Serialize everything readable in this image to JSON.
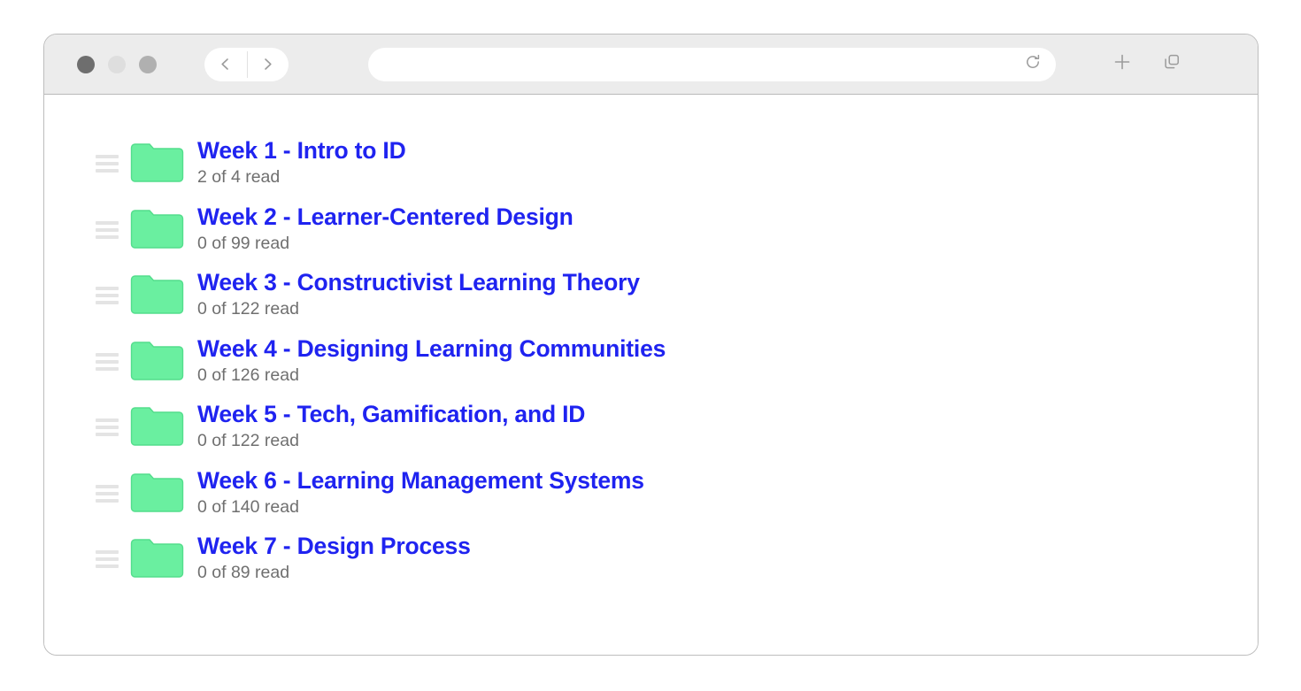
{
  "window": {
    "traffic_lights": [
      {
        "name": "close",
        "color": "#6e6e6e"
      },
      {
        "name": "minimize",
        "color": "#dedede"
      },
      {
        "name": "maximize",
        "color": "#b0b0b0"
      }
    ],
    "back_icon": "chevron-left-icon",
    "forward_icon": "chevron-right-icon",
    "reload_icon": "reload-icon",
    "new_tab_icon": "plus-icon",
    "tab_overview_icon": "tab-overview-icon"
  },
  "address_bar": {
    "value": "",
    "placeholder": ""
  },
  "theme": {
    "title_color": "#1f23f0",
    "subtitle_color": "#6f6f6f",
    "folder_color": "#6aefa0",
    "folder_color_dark": "#53dd8c",
    "toolbar_bg": "#ececec",
    "page_bg": "#ffffff"
  },
  "main": {
    "folders": [
      {
        "title": "Week 1 - Intro to ID",
        "status": "2 of 4 read",
        "icon": "folder-icon"
      },
      {
        "title": "Week 2 - Learner-Centered Design",
        "status": "0 of 99 read",
        "icon": "folder-icon"
      },
      {
        "title": "Week 3 - Constructivist Learning Theory",
        "status": "0 of 122 read",
        "icon": "folder-icon"
      },
      {
        "title": "Week 4 - Designing Learning Communities",
        "status": "0 of 126 read",
        "icon": "folder-icon"
      },
      {
        "title": "Week 5 - Tech, Gamification, and ID",
        "status": "0 of 122 read",
        "icon": "folder-icon"
      },
      {
        "title": "Week 6 - Learning Management Systems",
        "status": "0 of 140 read",
        "icon": "folder-icon"
      },
      {
        "title": "Week 7 - Design Process",
        "status": "0 of 89 read",
        "icon": "folder-icon"
      }
    ]
  }
}
